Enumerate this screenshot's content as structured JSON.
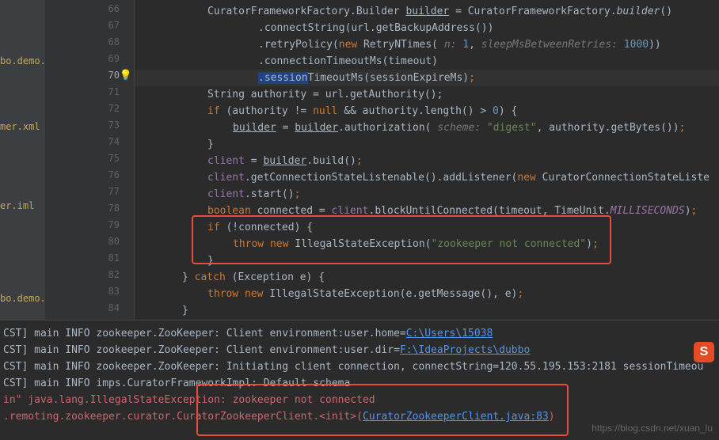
{
  "files": {
    "f1": "bo.demo.co",
    "f2": "mer.xml",
    "f3": "er.iml",
    "f4": "bo.demo.pro"
  },
  "gutter": {
    "start": 66,
    "end": 84,
    "highlight": 70
  },
  "code": {
    "l66a": "CuratorFrameworkFactory.Builder ",
    "l66b": "builder",
    "l66c": " = CuratorFrameworkFactory.",
    "l66d": "builder",
    "l66e": "()",
    "l67a": ".connectString(url.getBackupAddress())",
    "l68a": ".retryPolicy(",
    "l68b": "new",
    "l68c": " RetryNTimes( ",
    "l68d": "n:",
    "l68e": " 1",
    "l68f": ",  ",
    "l68g": "sleepMsBetweenRetries:",
    "l68h": " 1000",
    "l68i": "))",
    "l69a": ".connectionTimeoutMs(timeout)",
    "l70a": ".session",
    "l70b": "TimeoutMs(sessionExpireMs)",
    "l70c": ";",
    "l71a": "String authority = url.getAuthority();",
    "l72a": "if",
    "l72b": " (authority != ",
    "l72c": "null",
    "l72d": " && authority.length() > ",
    "l72e": "0",
    "l72f": ") {",
    "l73a": "builder",
    "l73b": " = ",
    "l73c": "builder",
    "l73d": ".authorization( ",
    "l73e": "scheme:",
    "l73f": " \"digest\"",
    "l73g": ", authority.getBytes())",
    "l73h": ";",
    "l74a": "}",
    "l75a": "client",
    "l75b": " = ",
    "l75c": "builder",
    "l75d": ".build()",
    "l75e": ";",
    "l76a": "client",
    "l76b": ".getConnectionStateListenable().addListener(",
    "l76c": "new",
    "l76d": " CuratorConnectionStateListe",
    "l77a": "client",
    "l77b": ".start()",
    "l77c": ";",
    "l78a": "boolean",
    "l78b": " connected = ",
    "l78c": "client",
    "l78d": ".blockUntilConnected(timeout, TimeUnit.",
    "l78e": "MILLISECONDS",
    "l78f": ")",
    "l78g": ";",
    "l79a": "if",
    "l79b": " (!connected) {",
    "l80a": "throw new",
    "l80b": " IllegalStateException(",
    "l80c": "\"zookeeper not connected\"",
    "l80d": ")",
    "l80e": ";",
    "l81a": "}",
    "l82a": "} ",
    "l82b": "catch",
    "l82c": " (Exception e) {",
    "l83a": "throw new",
    "l83b": " IllegalStateException(e.getMessage(), e)",
    "l83c": ";",
    "l84a": "}"
  },
  "console": {
    "c1a": "CST] main  INFO zookeeper.ZooKeeper: Client environment:user.home=",
    "c1b": "C:\\Users\\15038",
    "c2a": "CST] main  INFO zookeeper.ZooKeeper: Client environment:user.dir=",
    "c2b": "F:\\IdeaProjects\\dubbo",
    "c3": "CST] main  INFO zookeeper.ZooKeeper: Initiating client connection, connectString=120.55.195.153:2181 sessionTimeou",
    "c4": "CST] main  INFO imps.CuratorFrameworkImpl: Default schema",
    "c5": "in\" java.lang.IllegalStateException: zookeeper not connected",
    "c6a": ".remoting.zookeeper.curator.CuratorZookeeperClient.<init>(",
    "c6b": "CuratorZookeeperClient.java:83",
    "c6c": ")"
  },
  "watermark": "https://blog.csdn.net/xuan_lu",
  "icon": {
    "s": "S"
  }
}
